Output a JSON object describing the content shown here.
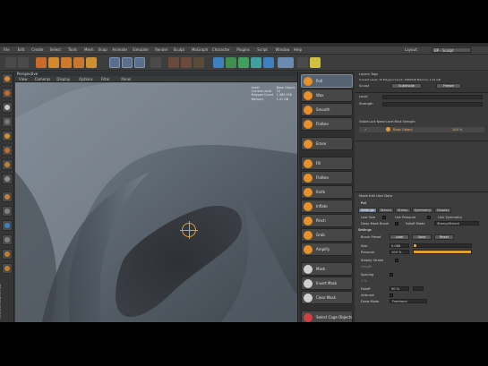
{
  "menubar": {
    "items": [
      "File",
      "Edit",
      "Create",
      "Select",
      "Tools",
      "Mesh",
      "Snap",
      "Animate",
      "Simulate",
      "Render",
      "Sculpt",
      "MoGraph",
      "Character",
      "Plugins",
      "Script",
      "Window",
      "Help"
    ],
    "layout_label": "Layout:",
    "layout_value": "BP - Sculpt"
  },
  "viewport": {
    "title": "Perspective",
    "menu": [
      "View",
      "Cameras",
      "Display",
      "Options",
      "Filter",
      "Panel"
    ],
    "hud": [
      {
        "k": "Level",
        "v": "Base Object"
      },
      {
        "k": "Current Level",
        "v": "10"
      },
      {
        "k": "Polygon Count",
        "v": "1,489,536"
      },
      {
        "k": "Memory",
        "v": "1.41 GB"
      }
    ]
  },
  "palette": {
    "groups": [
      {
        "items": [
          {
            "label": "Pull",
            "color": "#e8902a",
            "active": true
          },
          {
            "label": "Wax",
            "color": "#e8902a"
          },
          {
            "label": "Smooth",
            "color": "#e8902a"
          },
          {
            "label": "Flatten",
            "color": "#e8902a"
          }
        ]
      },
      {
        "items": [
          {
            "label": "Erase",
            "color": "#e8902a"
          }
        ]
      },
      {
        "items": [
          {
            "label": "Fill",
            "color": "#e8902a"
          },
          {
            "label": "Flatten",
            "color": "#e8902a"
          },
          {
            "label": "Knife",
            "color": "#e8902a"
          },
          {
            "label": "Inflate",
            "color": "#e8902a"
          },
          {
            "label": "Pinch",
            "color": "#e8902a"
          },
          {
            "label": "Grab",
            "color": "#e8902a"
          },
          {
            "label": "Amplify",
            "color": "#e8902a"
          }
        ]
      },
      {
        "items": [
          {
            "label": "Mask",
            "color": "#cfcfcf"
          },
          {
            "label": "Invert Mask",
            "color": "#cfcfcf"
          },
          {
            "label": "Clear Mask",
            "color": "#cfcfcf"
          }
        ]
      },
      {
        "items": [
          {
            "label": "Select Cage Objects",
            "color": "#d04040"
          }
        ]
      }
    ]
  },
  "objects": {
    "row1": "Layers   Tags",
    "row2": "Current Level: 10   Polygon Count: 1489536   Memory: 1.41 GB",
    "sculpt_label": "Sculpt",
    "subdivide": "Subdivide",
    "freeze": "Freeze"
  },
  "layers": {
    "level_label": "Level",
    "strength_label": "Strength",
    "headers": "Visible  Lock  Name                 Level  Mask  Strength",
    "layer_name": "Base Object",
    "layer_strength": "100 %"
  },
  "attributes": {
    "menu": "Mode   Edit   User Data",
    "title": "Pull",
    "tabs": [
      "Settings",
      "Stencil",
      "Stamp",
      "Symmetry",
      "Display"
    ],
    "row_last_size": "Last Size",
    "row_use_pressure": "Use Pressure",
    "row_link_symmetry": "Link Symmetry",
    "row_deep_mask": "Deep Mask Brush",
    "row_falloff_label": "Falloff Mode",
    "row_falloff_value": "Stamp/Stencil",
    "section": "Settings",
    "brush_preset_label": "Brush Preset",
    "load_btn": "Load",
    "save_btn": "Save",
    "reset_btn": "Reset",
    "size_label": "Size",
    "size_value": "0.088",
    "size_fraction": 0.05,
    "pressure_label": "Pressure",
    "pressure_value": "100 %",
    "pressure_fraction": 1.0,
    "steady_label": "Steady Stroke",
    "steady_length_label": "Length",
    "spacing_label": "Spacing",
    "spacing_value": "1 %",
    "falloff2_label": "Falloff",
    "falloff2_value": "50 %",
    "airbrush_label": "Airbrush",
    "draw_mode_label": "Draw Mode",
    "draw_mode_value": "Freehand"
  },
  "colors": {
    "accent": "#e8902a",
    "selection": "#5b6f8c"
  }
}
